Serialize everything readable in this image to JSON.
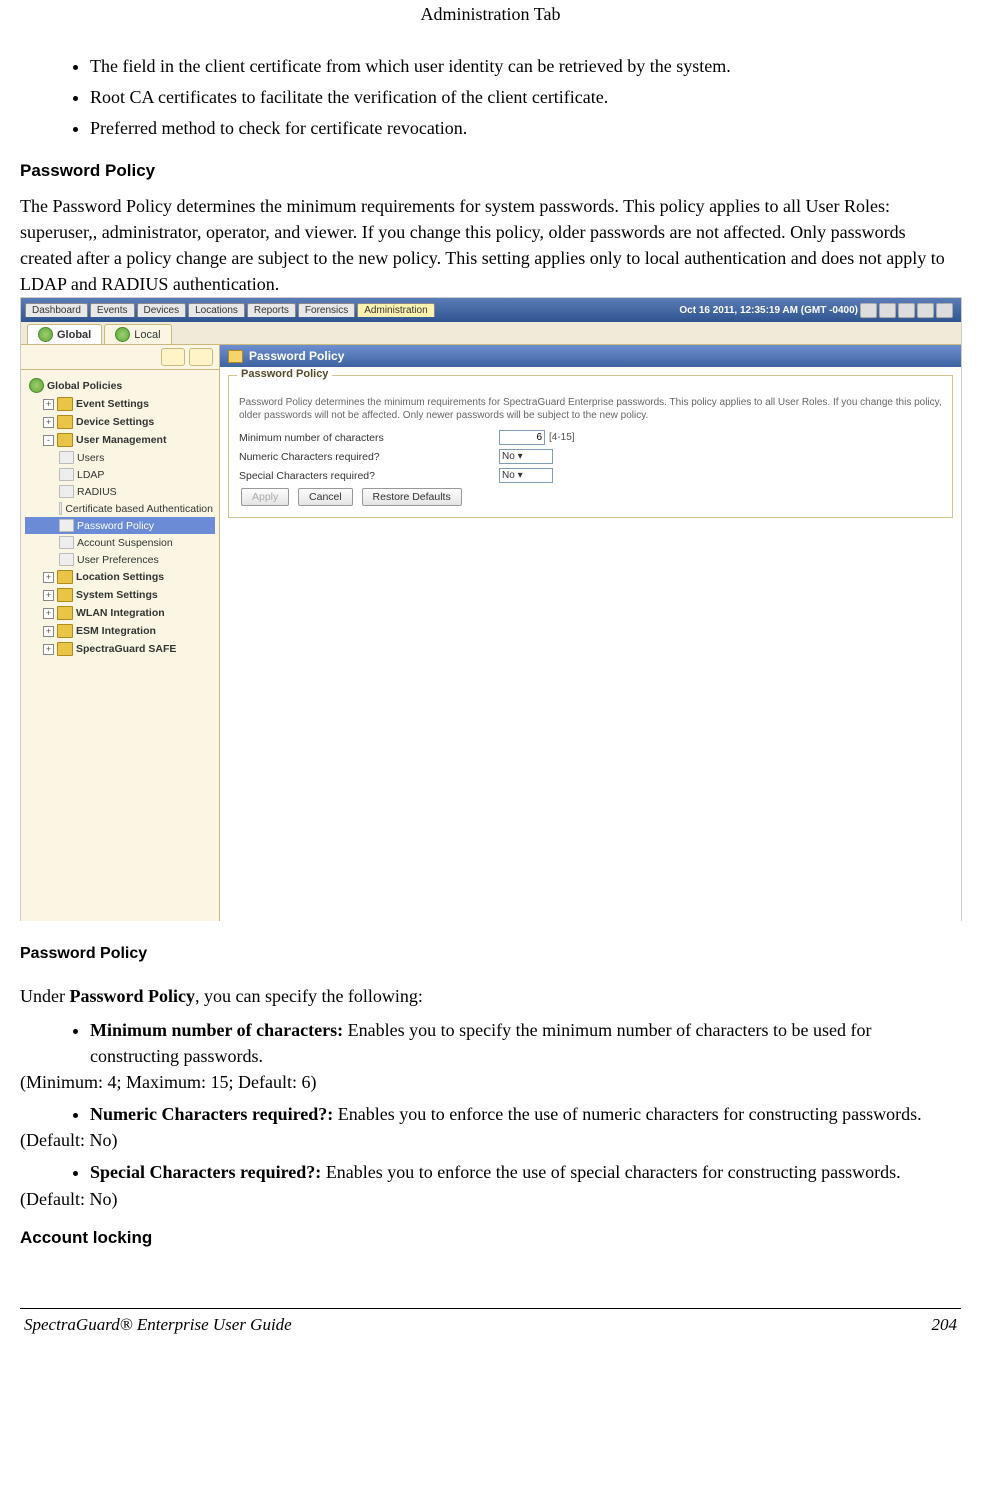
{
  "pageHeader": "Administration Tab",
  "topBullets": [
    "The field in the client certificate from which user identity can be retrieved by the system.",
    "Root CA certificates to facilitate the verification of the client certificate.",
    "Preferred method to check for certificate revocation."
  ],
  "section1Title": "Password Policy",
  "section1Body": "The Password Policy determines the minimum requirements for system passwords. This policy applies to all User Roles: superuser,, administrator, operator, and viewer. If you change this policy, older passwords are not affected. Only passwords created after a policy change are subject to the new policy. This setting applies only to local authentication and does not apply to LDAP and RADIUS authentication.",
  "app": {
    "mainTabs": [
      "Dashboard",
      "Events",
      "Devices",
      "Locations",
      "Reports",
      "Forensics",
      "Administration"
    ],
    "activeMainTab": "Administration",
    "timestamp": "Oct 16 2011, 12:35:19 AM (GMT -0400)",
    "subTabs": [
      "Global",
      "Local"
    ],
    "activeSubTab": "Global",
    "tree": {
      "root": "Global Policies",
      "nodes": [
        {
          "label": "Event Settings",
          "type": "folder",
          "expander": "+"
        },
        {
          "label": "Device Settings",
          "type": "folder",
          "expander": "+"
        },
        {
          "label": "User Management",
          "type": "folder",
          "expander": "-",
          "children": [
            {
              "label": "Users"
            },
            {
              "label": "LDAP"
            },
            {
              "label": "RADIUS"
            },
            {
              "label": "Certificate based Authentication"
            },
            {
              "label": "Password Policy",
              "selected": true
            },
            {
              "label": "Account Suspension"
            },
            {
              "label": "User Preferences"
            }
          ]
        },
        {
          "label": "Location Settings",
          "type": "folder",
          "expander": "+"
        },
        {
          "label": "System Settings",
          "type": "folder",
          "expander": "+"
        },
        {
          "label": "WLAN Integration",
          "type": "folder",
          "expander": "+"
        },
        {
          "label": "ESM Integration",
          "type": "folder",
          "expander": "+"
        },
        {
          "label": "SpectraGuard SAFE",
          "type": "folder",
          "expander": "+"
        }
      ]
    },
    "panel": {
      "title": "Password Policy",
      "legend": "Password Policy",
      "desc": "Password Policy determines the minimum requirements for SpectraGuard Enterprise passwords. This policy applies to all User Roles. If you change this policy, older passwords will not be affected. Only newer passwords will be subject to the new policy.",
      "rows": {
        "minLabel": "Minimum number of characters",
        "minValue": "6",
        "minRange": "[4-15]",
        "numLabel": "Numeric Characters required?",
        "numValue": "No",
        "spLabel": "Special Characters required?",
        "spValue": "No"
      },
      "buttons": {
        "apply": "Apply",
        "cancel": "Cancel",
        "restore": "Restore Defaults"
      }
    }
  },
  "section2Title": "Password Policy",
  "afterIntroPre": "Under ",
  "afterIntroBold": "Password Policy",
  "afterIntroPost": ", you can specify the following:",
  "items": [
    {
      "bold": "Minimum number of characters:",
      "rest": " Enables you to specify the minimum number of characters to be used for constructing passwords.",
      "note": "(Minimum: 4; Maximum: 15; Default: 6)"
    },
    {
      "bold": "Numeric Characters required?:",
      "rest": " Enables you to enforce the use of numeric characters for constructing passwords.",
      "note": "(Default: No)"
    },
    {
      "bold": "Special Characters required?:",
      "rest": " Enables you to enforce the use of special characters for constructing passwords.",
      "note": "(Default: No)"
    }
  ],
  "section3Title": "Account locking",
  "footerTitle": "SpectraGuard® Enterprise User Guide",
  "footerPage": "204"
}
